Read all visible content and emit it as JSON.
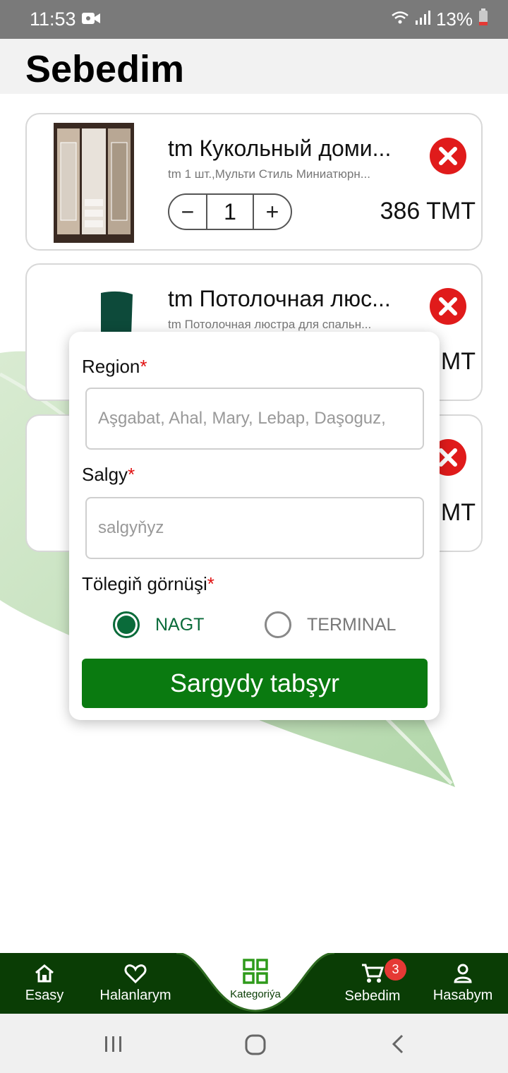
{
  "status_bar": {
    "time": "11:53",
    "battery": "13%"
  },
  "header": {
    "title": "Sebedim"
  },
  "cart": {
    "items": [
      {
        "title": "tm Кукольный доми...",
        "subtitle": "tm 1 шт.,Мульти Стиль Миниатюрн...",
        "quantity": "1",
        "price": "386 TMT"
      },
      {
        "title": "tm Потолочная люс...",
        "subtitle": "tm Потолочная люстра для спальн...",
        "price": "MT"
      },
      {
        "price": "MT"
      }
    ]
  },
  "order_form": {
    "region_label": "Region",
    "region_placeholder": "Aşgabat, Ahal, Mary, Lebap, Daşoguz,",
    "address_label": "Salgy",
    "address_placeholder": "salgyňyz",
    "payment_label": "Tölegiň görnüşi",
    "required_mark": "*",
    "payment_options": [
      {
        "label": "NAGT",
        "selected": true
      },
      {
        "label": "TERMINAL",
        "selected": false
      }
    ],
    "submit_label": "Sargydy tabşyr"
  },
  "bottom_nav": {
    "items": [
      {
        "label": "Esasy",
        "icon": "home-icon"
      },
      {
        "label": "Halanlarym",
        "icon": "heart-icon"
      },
      {
        "label": "Kategoriýa",
        "icon": "grid-icon"
      },
      {
        "label": "Sebedim",
        "icon": "cart-icon",
        "badge": "3"
      },
      {
        "label": "Hasabym",
        "icon": "person-icon"
      }
    ]
  },
  "colors": {
    "brand_green": "#0a7a10",
    "nav_dark": "#0a3d05",
    "remove_red": "#e01b1b",
    "required_red": "#e01010"
  }
}
